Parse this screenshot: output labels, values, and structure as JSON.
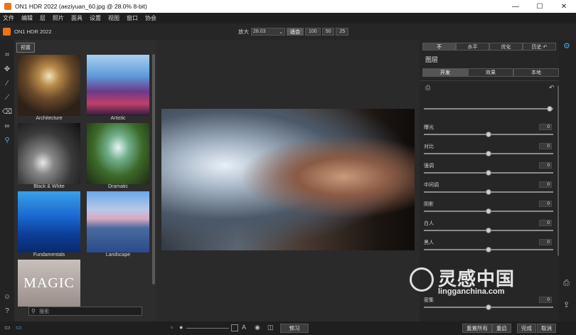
{
  "window": {
    "title": "ON1 HDR 2022 (aeziyuan_60.jpg @ 28.0% 8-bit)",
    "controls": [
      "—",
      "☐",
      "✕"
    ]
  },
  "menu": [
    "文件",
    "编辑",
    "层",
    "照片",
    "面具",
    "设置",
    "视图",
    "窗口",
    "协会"
  ],
  "toolbar": {
    "brand": "ON1 HDR 2022",
    "zoom_label": "放大",
    "zoom_value": "28.03",
    "fit_buttons": [
      "适合",
      "100",
      "50",
      "25"
    ]
  },
  "browser": {
    "tab": "预置",
    "presets": [
      {
        "label": "Architecture"
      },
      {
        "label": "Artistic"
      },
      {
        "label": "Black & White"
      },
      {
        "label": "Dramatic"
      },
      {
        "label": "Fundamentals"
      },
      {
        "label": "Landscape"
      },
      {
        "label": ""
      }
    ],
    "magic_text": "MAGIC",
    "search_placeholder": "搜索"
  },
  "right_panel": {
    "top_tabs": [
      "不",
      "水平",
      "优化",
      "历史 ↶"
    ],
    "layers_title": "图层",
    "sub_tabs": [
      "开发",
      "效果",
      "本地"
    ],
    "sliders": [
      {
        "label": "",
        "value": "",
        "level": 0.97
      },
      {
        "label": "曝光",
        "value": "0",
        "level": 0.5
      },
      {
        "label": "对比",
        "value": "0",
        "level": 0.5
      },
      {
        "label": "强调",
        "value": "0",
        "level": 0.5
      },
      {
        "label": "中间调",
        "value": "0",
        "level": 0.5
      },
      {
        "label": "阴影",
        "value": "0",
        "level": 0.5
      },
      {
        "label": "白人",
        "value": "0",
        "level": 0.5
      },
      {
        "label": "黑人",
        "value": "0",
        "level": 0.5
      },
      {
        "label": "密集",
        "value": "0",
        "level": 0.5
      }
    ]
  },
  "bottom": {
    "compare_label": "预习",
    "reset_all": "重置所有",
    "reset": "重启",
    "done": "完成",
    "cancel": "取消"
  },
  "watermark": {
    "chinese": "灵感中国",
    "url": "lingganchina.com"
  }
}
